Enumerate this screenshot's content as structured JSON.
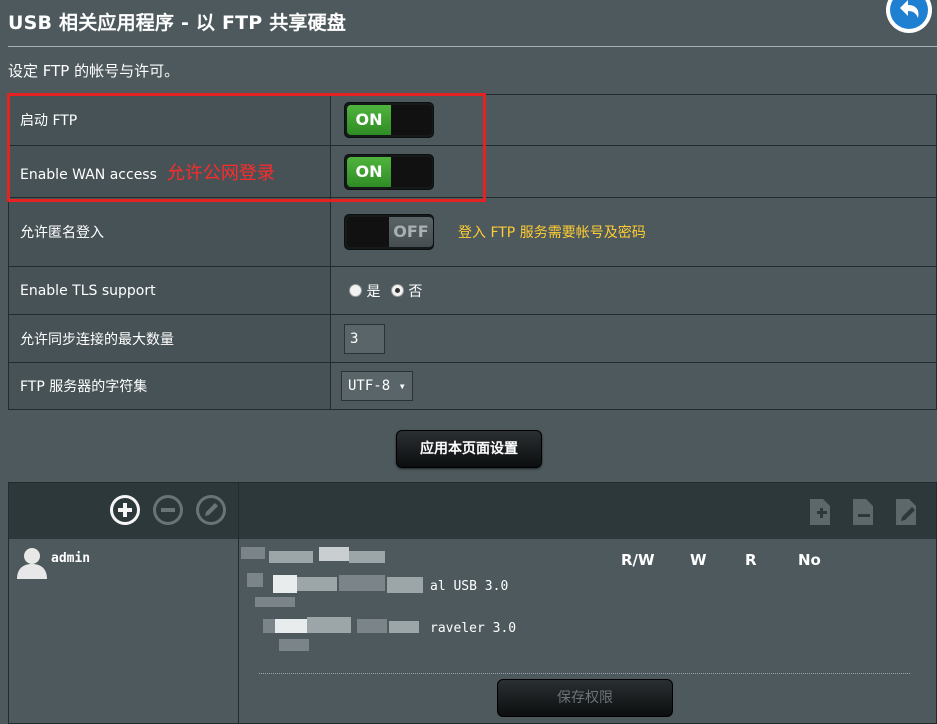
{
  "header": {
    "title": "USB 相关应用程序 - 以 FTP 共享硬盘",
    "back_icon": "back-arrow-icon",
    "subtitle": "设定 FTP 的帐号与许可。"
  },
  "settings": {
    "enable_ftp": {
      "label": "启动 FTP",
      "state": "ON"
    },
    "wan_access": {
      "label": "Enable WAN access",
      "state": "ON",
      "annotation": "允许公网登录"
    },
    "anonymous": {
      "label": "允许匿名登入",
      "state": "OFF",
      "hint": "登入 FTP 服务需要帐号及密码"
    },
    "tls": {
      "label": "Enable TLS support",
      "option_yes": "是",
      "option_no": "否",
      "selected": "否"
    },
    "max_connections": {
      "label": "允许同步连接的最大数量",
      "value": "3"
    },
    "charset": {
      "label": "FTP 服务器的字符集",
      "value": "UTF-8",
      "arrow": "▾"
    }
  },
  "apply_button": "应用本页面设置",
  "accounts": {
    "users": [
      {
        "name": "admin",
        "icon": "user-icon"
      }
    ],
    "columns": [
      "R/W",
      "W",
      "R",
      "No"
    ],
    "devices": [
      "al USB 3.0",
      "raveler 3.0"
    ],
    "save_button": "保存权限"
  },
  "colors": {
    "accent_red": "#ff2b2b",
    "hint_orange": "#ffcc33",
    "toggle_green": "#3fa030"
  }
}
